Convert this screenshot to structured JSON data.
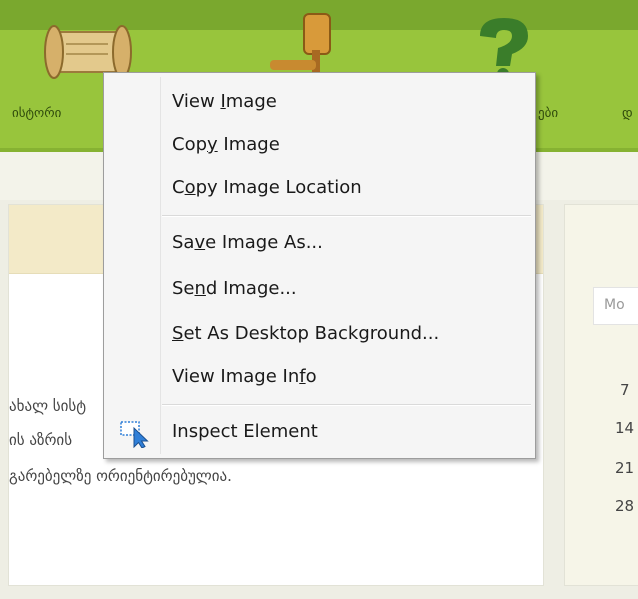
{
  "header": {
    "nav": [
      {
        "label": "ისტორი"
      },
      {
        "label": "ები"
      },
      {
        "label": "დ"
      }
    ]
  },
  "main": {
    "lines": [
      "ახალ სისტ",
      "ის აზრის",
      "გარებელზე ორიენტირებულია."
    ]
  },
  "sidebar": {
    "weekday": "Mo",
    "dates": [
      "7",
      "14",
      "21",
      "28"
    ]
  },
  "context_menu": {
    "groups": [
      [
        {
          "label": "View Image",
          "accesskey": "I"
        },
        {
          "label": "Copy Image",
          "accesskey": "y"
        },
        {
          "label": "Copy Image Location",
          "accesskey": "o"
        }
      ],
      [
        {
          "label": "Save Image As...",
          "accesskey": "v"
        },
        {
          "label": "Send Image...",
          "accesskey": "n"
        },
        {
          "label": "Set As Desktop Background...",
          "accesskey": "S"
        },
        {
          "label": "View Image Info",
          "accesskey": "f"
        }
      ],
      [
        {
          "label": "Inspect Element",
          "accesskey": "",
          "icon": "inspect-cursor-icon"
        }
      ]
    ]
  },
  "colors": {
    "header_green": "#98c53c",
    "menu_bg": "#f5f5f5",
    "inspect_icon_blue": "#2f7fd8"
  }
}
